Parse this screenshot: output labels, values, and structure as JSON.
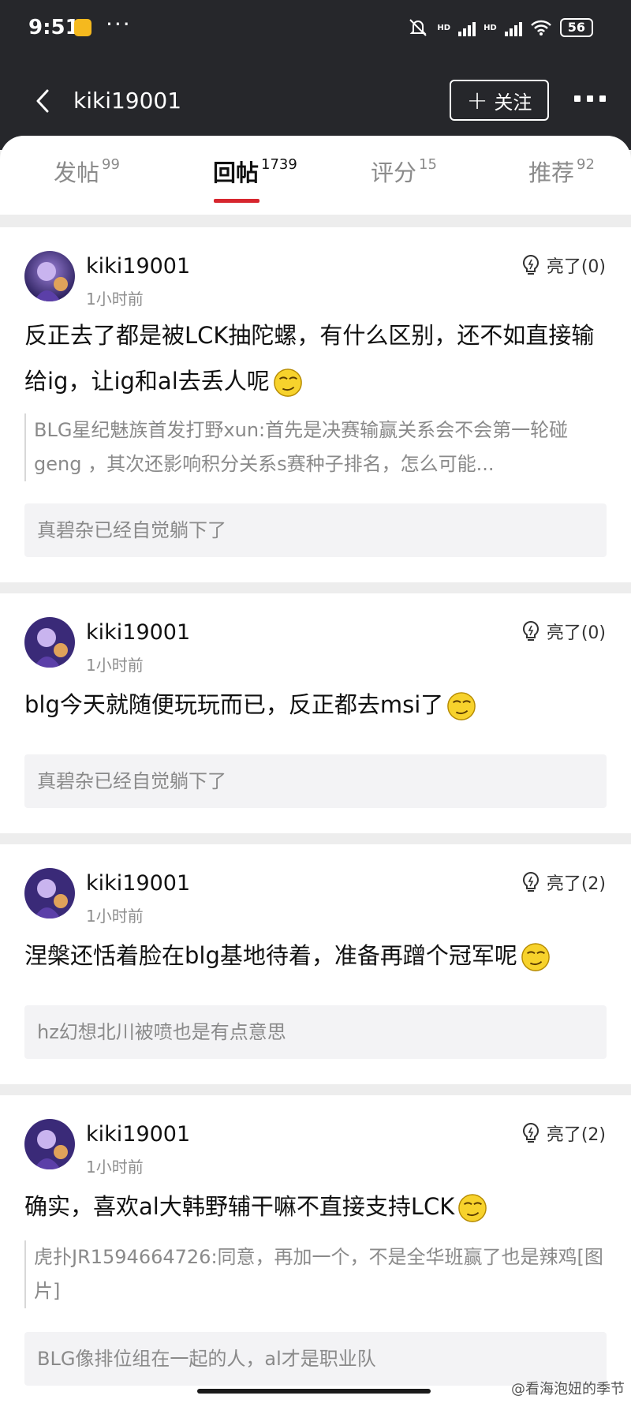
{
  "status_bar": {
    "time": "9:51",
    "dots": "···",
    "hd1": "HD",
    "hd2": "HD",
    "battery": "56"
  },
  "nav": {
    "title": "kiki19001",
    "follow_label": "关注"
  },
  "tabs": [
    {
      "label": "发帖",
      "count": "99"
    },
    {
      "label": "回帖",
      "count": "1739"
    },
    {
      "label": "评分",
      "count": "15"
    },
    {
      "label": "推荐",
      "count": "92"
    }
  ],
  "posts": [
    {
      "username": "kiki19001",
      "time": "1小时前",
      "like": "亮了(0)",
      "content": "反正去了都是被LCK抽陀螺，有什么区别，还不如直接输给ig，让ig和al去丢人呢",
      "quote": "BLG星纪魅族首发打野xun:首先是决赛输赢关系会不会第一轮碰geng ，其次还影响积分关系s赛种子排名，怎么可能...",
      "reply": "真碧杂已经自觉躺下了"
    },
    {
      "username": "kiki19001",
      "time": "1小时前",
      "like": "亮了(0)",
      "content": "blg今天就随便玩玩而已，反正都去msi了",
      "reply": "真碧杂已经自觉躺下了"
    },
    {
      "username": "kiki19001",
      "time": "1小时前",
      "like": "亮了(2)",
      "content": "涅槃还恬着脸在blg基地待着，准备再蹭个冠军呢",
      "reply": "hz幻想北川被喷也是有点意思"
    },
    {
      "username": "kiki19001",
      "time": "1小时前",
      "like": "亮了(2)",
      "content": "确实，喜欢al大韩野辅干嘛不直接支持LCK",
      "quote": "虎扑JR1594664726:同意，再加一个，不是全华班赢了也是辣鸡[图片]",
      "reply": "BLG像排位组在一起的人，al才是职业队"
    }
  ],
  "watermark": "@看海泡妞的季节",
  "colors": {
    "header_bg": "#26272b",
    "accent_red": "#d7262e",
    "muted_text": "#8a8a8a"
  }
}
